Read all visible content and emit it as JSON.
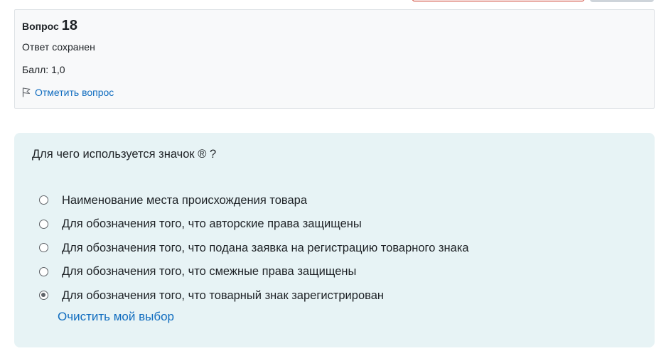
{
  "info": {
    "question_prefix": "Вопрос",
    "question_number": "18",
    "state": "Ответ сохранен",
    "grade": "Балл: 1,0",
    "flag_label": "Отметить вопрос"
  },
  "question": {
    "text": "Для чего используется значок ® ?",
    "answers": [
      {
        "label": "Наименование места происхождения товара",
        "checked": false
      },
      {
        "label": "Для обозначения того, что авторские права защищены",
        "checked": false
      },
      {
        "label": "Для обозначения того, что подана заявка на регистрацию товарного знака",
        "checked": false
      },
      {
        "label": "Для обозначения того, что смежные права защищены",
        "checked": false
      },
      {
        "label": "Для обозначения того, что товарный знак зарегистрирован",
        "checked": true
      }
    ],
    "clear_label": "Очистить мой выбор"
  },
  "colors": {
    "link": "#0f6cbf",
    "content_bg": "#e7f3f5",
    "info_bg": "#f8f9fa",
    "danger_border": "#ca3120"
  },
  "icons": {
    "flag": "flag-icon"
  }
}
